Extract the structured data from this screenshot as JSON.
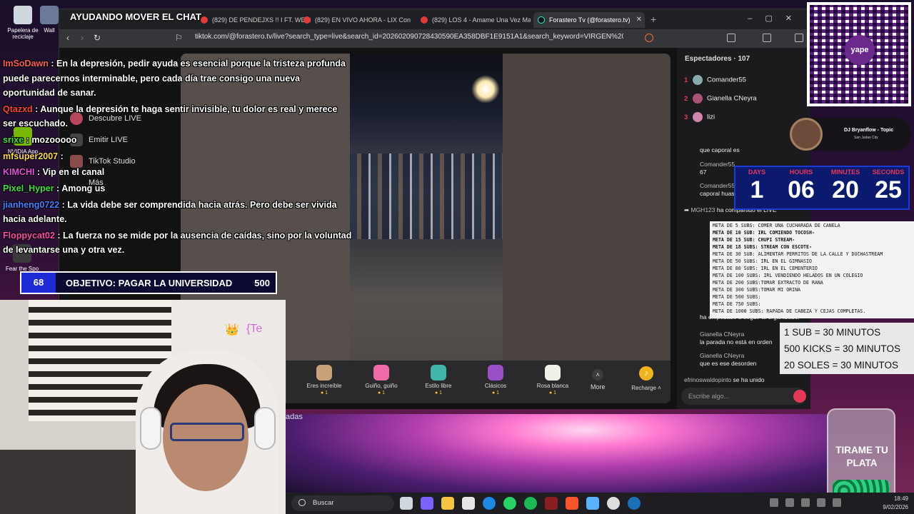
{
  "desktop": {
    "icons": [
      {
        "label": "Papelera de reciclaje",
        "icon": "recycle-bin-icon"
      },
      {
        "label": "Wall",
        "icon": "folder-icon"
      },
      {
        "label": "NVIDIA App",
        "icon": "nvidia-icon"
      },
      {
        "label": "Fear the Spo",
        "icon": "game-icon"
      }
    ],
    "stray_text": "adas"
  },
  "browser": {
    "tabs": [
      {
        "label": "(829) DE PENDEJXS !! I FT. WENDY G"
      },
      {
        "label": "(829) EN VIVO AHORA - LIX Con"
      },
      {
        "label": "(829) LOS 4 - Amame Una Vez Mas"
      },
      {
        "label": "Forastero Tv (@forastero.tv)"
      }
    ],
    "url": "tiktok.com/@forastero.tv/live?search_type=live&search_id=202602090728430590EA358DBF1E9151A1&search_keyword=VIRGEN%20D...",
    "sidebar": [
      {
        "label": "Descubre LIVE"
      },
      {
        "label": "Emitir LIVE"
      },
      {
        "label": "TikTok Studio"
      },
      {
        "label": "Más"
      }
    ],
    "gifts": [
      {
        "name": "Eres increíble",
        "cost": "1",
        "color": "#c9a27a"
      },
      {
        "name": "Guiño, guiño",
        "cost": "1",
        "color": "#f06aa8"
      },
      {
        "name": "Estilo libre",
        "cost": "1",
        "color": "#3fb6a8"
      },
      {
        "name": "Clásicos",
        "cost": "1",
        "color": "#9a4fc9"
      },
      {
        "name": "Rosa blanca",
        "cost": "1",
        "color": "#f0f0e8"
      }
    ],
    "more_label": "More",
    "recharge_label": "Recharge",
    "viewers_title": "Espectadores · 107",
    "viewers": [
      {
        "rank": "1",
        "name": "Comander55"
      },
      {
        "rank": "2",
        "name": "Gianella CNeyra"
      },
      {
        "rank": "3",
        "name": "lizi"
      }
    ],
    "chat": [
      {
        "user": "",
        "text": "que caporal es"
      },
      {
        "user": "Comander55",
        "text": "67"
      },
      {
        "user": "Comander55",
        "text": "caporal huascar"
      },
      {
        "user": "MGH123",
        "text": "ha compartido el LIVE"
      },
      {
        "user": "",
        "text": "ha empezado a seguir al organizador"
      },
      {
        "user": "Gianella CNeyra",
        "text": "la parada no está en orden"
      },
      {
        "user": "Gianella CNeyra",
        "text": "que es ese desorden"
      },
      {
        "user": "efrinoswaldopinto",
        "text": "se ha unido"
      }
    ],
    "chat_placeholder": "Escribe algo..."
  },
  "overlay": {
    "title": "AYUDANDO MOVER EL CHAT",
    "messages": [
      {
        "user": "ImSoDawn",
        "color": "#ff5b5b",
        "text": "En la depresión, pedir ayuda es esencial porque la tristeza profunda puede parecernos interminable, pero cada día trae consigo una nueva oportunidad de sanar."
      },
      {
        "user": "Qtazxd",
        "color": "#ff4040",
        "text": "Aunque la depresión te haga sentir invisible, tu dolor es real y merece ser escuchado."
      },
      {
        "user": "srixe",
        "color": "#3ce03c",
        "text": "mozooooo"
      },
      {
        "user": "mfsuper2007",
        "color": "#ffd84a",
        "text": ""
      },
      {
        "user": "KIMCHI",
        "color": "#e84ae0",
        "text": "Vip en el canal"
      },
      {
        "user": "Pixel_Hyper",
        "color": "#3ce03c",
        "text": "Among us"
      },
      {
        "user": "jianheng0722",
        "color": "#4a7dff",
        "text": "La vida debe ser comprendida hacia atrás. Pero debe ser vivida hacia adelante."
      },
      {
        "user": "Floppycat02",
        "color": "#ff4ab0",
        "text": "La fuerza no se mide por la ausencia de caídas, sino por la voluntad de levantarse una y otra vez."
      }
    ],
    "goal": {
      "count": "68",
      "text": "OBJETIVO: PAGAR LA UNIVERSIDAD",
      "target": "500"
    },
    "crown_emoji": "👑",
    "te_text": "{Te",
    "countdown": [
      {
        "label": "DAYS",
        "value": "1"
      },
      {
        "label": "HOURS",
        "value": "06"
      },
      {
        "label": "MINUTES",
        "value": "20"
      },
      {
        "label": "SECONDS",
        "value": "25"
      }
    ],
    "dj": {
      "title": "DJ Bryanflow - Topic",
      "subtitle": "San Judas City"
    },
    "meta_goals": [
      {
        "text": "META DE 5 SUBS: COMER UNA CUCHARADA DE CANELA",
        "bold": false
      },
      {
        "text": "META DE 10 SUB: IRL COMIENDO TOCOSH-",
        "bold": true
      },
      {
        "text": "META DE 15 SUB: CHUPI STREAM-",
        "bold": true
      },
      {
        "text": "META DE 18 SUBS: STREAM CON ESCOTE-",
        "bold": true
      },
      {
        "text": "META DE 30 SUB:  ALIMENTAR PERRITOS DE LA CALLE Y DUCHASTREAM",
        "bold": false
      },
      {
        "text": "META DE 50 SUBS: IRL EN EL GIMNASIO",
        "bold": false
      },
      {
        "text": "META DE 80 SUBS: IRL EN EL CEMENTERIO",
        "bold": false
      },
      {
        "text": "META DE 100 SUBS: IRL VENDIENDO HELADOS EN UN COLEGIO",
        "bold": false
      },
      {
        "text": "META DE 200 SUBS:TOMAR EXTRACTO DE RANA",
        "bold": false
      },
      {
        "text": "META DE 300 SUBS:TOMAR MI ORINA",
        "bold": false
      },
      {
        "text": "META DE 500 SUBS:",
        "bold": false
      },
      {
        "text": "META DE 750 SUBS:",
        "bold": false
      },
      {
        "text": "META DE 1000 SUBS: RAPADA DE CABEZA Y CEJAS COMPLETAS.",
        "bold": false
      }
    ],
    "subs_rates": [
      "1 SUB = 30 MINUTOS",
      "500 KICKS = 30 MINUTOS",
      "20 SOLES = 30 MINUTOS"
    ],
    "qr_logo": "yape",
    "jar_text": "TIRAME TU PLATA"
  },
  "taskbar": {
    "search_placeholder": "Buscar",
    "time": "18:49",
    "date": "9/02/2026",
    "apps": [
      {
        "icon": "task-view-icon",
        "color": "#cfd8dc"
      },
      {
        "icon": "copilot-icon",
        "color": "#7b61ff"
      },
      {
        "icon": "file-explorer-icon",
        "color": "#f4c542"
      },
      {
        "icon": "store-icon",
        "color": "#e6e6e6"
      },
      {
        "icon": "edge-icon",
        "color": "#1e88e5"
      },
      {
        "icon": "whatsapp-icon",
        "color": "#25d366"
      },
      {
        "icon": "spotify-icon",
        "color": "#1db954"
      },
      {
        "icon": "game-app-icon",
        "color": "#8b1e1e"
      },
      {
        "icon": "brave-icon",
        "color": "#fb542b"
      },
      {
        "icon": "notepad-icon",
        "color": "#5ab2ff"
      },
      {
        "icon": "obs-icon",
        "color": "#dddddd"
      },
      {
        "icon": "steam-icon",
        "color": "#1b6fb5"
      }
    ]
  }
}
